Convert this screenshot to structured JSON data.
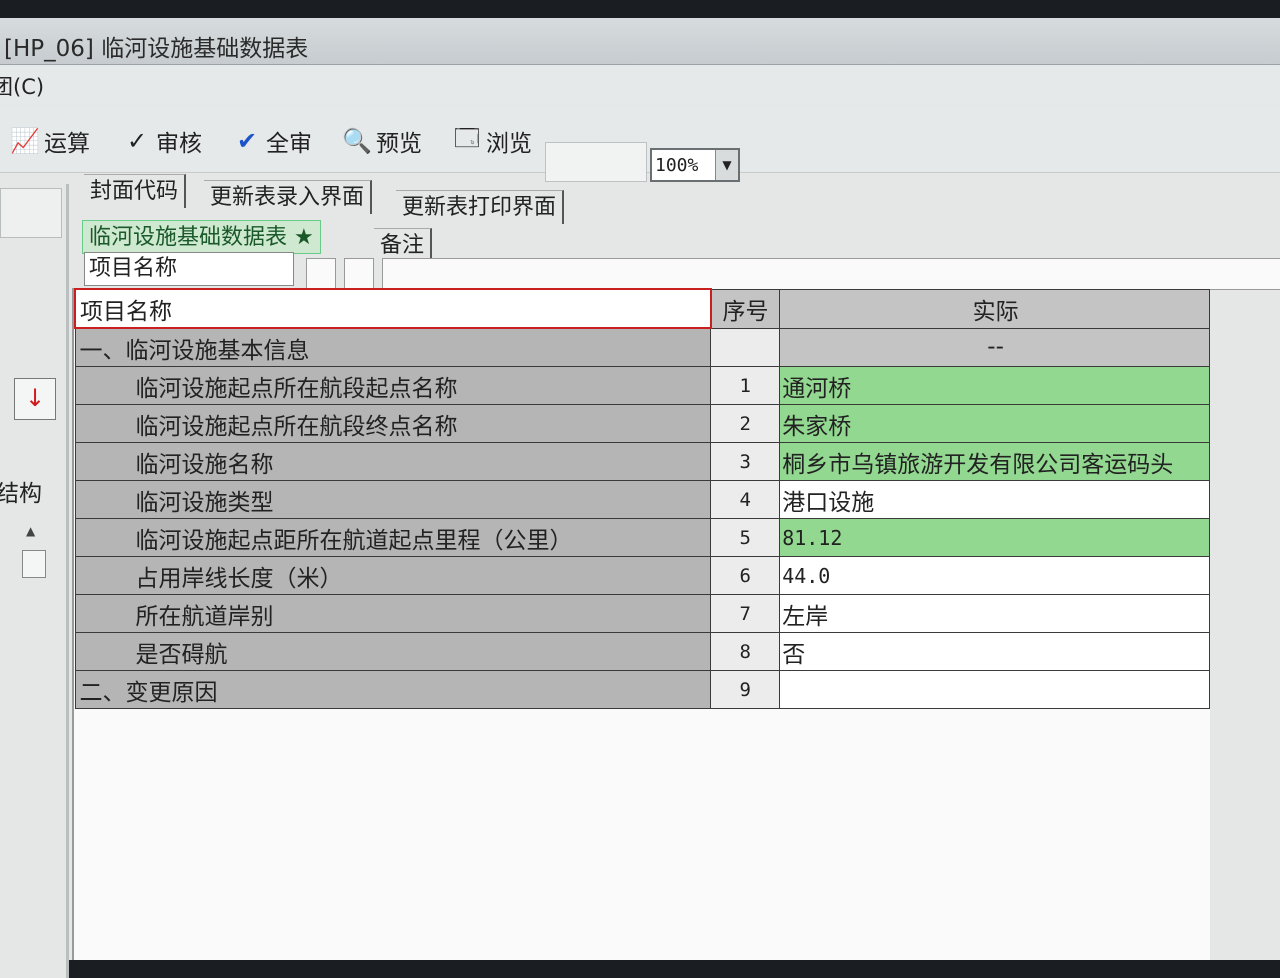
{
  "window": {
    "title": "[HP_06] 临河设施基础数据表"
  },
  "menu": {
    "label": "团(C)"
  },
  "toolbar": {
    "calc": "运算",
    "audit": "审核",
    "audit_all": "全审",
    "preview": "预览",
    "browse": "浏览",
    "zoom": "100%"
  },
  "tabs_top": [
    "封面代码",
    "更新表录入界面",
    "更新表打印界面"
  ],
  "tabs_sheet": [
    "临河设施基础数据表 ★",
    "备注"
  ],
  "filter": {
    "value": "项目名称"
  },
  "left_panel": {
    "label": "结构"
  },
  "table": {
    "header": {
      "name": "项目名称",
      "seq": "序号",
      "value": "实际"
    },
    "section_rows": [
      {
        "name": "一、临河设施基本信息",
        "seq": "",
        "value": "--"
      }
    ],
    "rows": [
      {
        "name": "临河设施起点所在航段起点名称",
        "seq": "1",
        "value": "通河桥"
      },
      {
        "name": "临河设施起点所在航段终点名称",
        "seq": "2",
        "value": "朱家桥"
      },
      {
        "name": "临河设施名称",
        "seq": "3",
        "value": "桐乡市乌镇旅游开发有限公司客运码头"
      },
      {
        "name": "临河设施类型",
        "seq": "4",
        "value": "港口设施"
      },
      {
        "name": "临河设施起点距所在航道起点里程（公里）",
        "seq": "5",
        "value": "81.12"
      },
      {
        "name": "占用岸线长度（米）",
        "seq": "6",
        "value": "44.0"
      },
      {
        "name": "所在航道岸别",
        "seq": "7",
        "value": "左岸"
      },
      {
        "name": "是否碍航",
        "seq": "8",
        "value": "否"
      }
    ],
    "footer_section": {
      "name": "二、变更原因",
      "seq": "9",
      "value": ""
    }
  },
  "colors": {
    "green_cell": "#92d890",
    "gray_cell": "#b5b5b5",
    "header_border": "#c91f1f"
  }
}
